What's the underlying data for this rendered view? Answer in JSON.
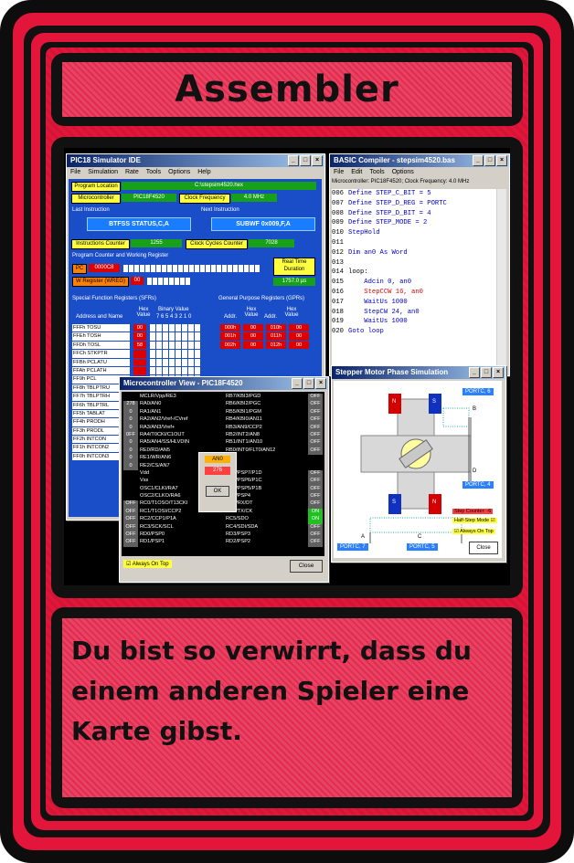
{
  "card": {
    "title": "Assembler",
    "description": "Du bist so verwirrt, dass du einem anderen Spieler eine Karte gibst."
  },
  "screenshot": {
    "pic_window": {
      "title": "PIC18 Simulator IDE",
      "menu": [
        "File",
        "Simulation",
        "Rate",
        "Tools",
        "Options",
        "Help"
      ],
      "program_location_label": "Program Location",
      "program_location_value": "C:\\stepsim4520.hex",
      "microcontroller_label": "Microcontroller",
      "microcontroller_value": "PIC18F4520",
      "clock_label": "Clock Frequency",
      "clock_value": "4.0 MHz",
      "last_instruction_label": "Last Instruction",
      "last_instruction_value": "BTFSS STATUS,C,A",
      "next_instruction_label": "Next Instruction",
      "next_instruction_value": "SUBWF 0x009,F,A",
      "instructions_counter_label": "Instructions Counter",
      "instructions_counter_value": "1255",
      "clock_cycles_label": "Clock Cycles Counter",
      "clock_cycles_value": "7028",
      "pc_group_label": "Program Counter and Working Register",
      "pc_label": "PC",
      "pc_value": "0000C8",
      "w_label": "W Register (WREG)",
      "w_value": "00",
      "realtime_label": "Real Time Duration",
      "realtime_value": "1757.0 µs",
      "sfr_label": "Special Function Registers (SFRs)",
      "sfr_col1": "Address and Name",
      "sfr_col2": "Hex Value",
      "sfr_col3": "Binary Value",
      "sfr_bits": "7 6 5 4 3 2 1 0",
      "gpr_label": "General Purpose Registers (GPRs)",
      "gpr_col_addr": "Addr.",
      "gpr_col_hex": "Hex Value",
      "sfr_rows": [
        {
          "name": "FFFh TOSU",
          "val": "00"
        },
        {
          "name": "FFEh TOSH",
          "val": "00"
        },
        {
          "name": "FFDh TOSL",
          "val": "58"
        },
        {
          "name": "FFCh STKPTR",
          "val": ""
        },
        {
          "name": "FFBh PCLATU",
          "val": ""
        },
        {
          "name": "FFAh PCLATH",
          "val": ""
        },
        {
          "name": "FF9h PCL",
          "val": ""
        },
        {
          "name": "FF8h TBLPTRU",
          "val": ""
        },
        {
          "name": "FF7h TBLPTRH",
          "val": ""
        },
        {
          "name": "FF6h TBLPTRL",
          "val": ""
        },
        {
          "name": "FF5h TABLAT",
          "val": ""
        },
        {
          "name": "FF4h PRODH",
          "val": ""
        },
        {
          "name": "FF3h PRODL",
          "val": ""
        },
        {
          "name": "FF2h INTCON",
          "val": ""
        },
        {
          "name": "FF1h INTCON2",
          "val": ""
        },
        {
          "name": "FF0h INTCON3",
          "val": ""
        }
      ],
      "gpr_rows": [
        {
          "a1": "000h",
          "v1": "00",
          "a2": "010h",
          "v2": "00"
        },
        {
          "a1": "001h",
          "v1": "00",
          "a2": "011h",
          "v2": "00"
        },
        {
          "a1": "002h",
          "v1": "00",
          "a2": "012h",
          "v2": "00"
        }
      ]
    },
    "basic_window": {
      "title": "BASIC Compiler - stepsim4520.bas",
      "menu": [
        "File",
        "Edit",
        "Tools",
        "Options"
      ],
      "status": "Microcontroller: PIC18F4520; Clock Frequency: 4.0 MHz",
      "lines": [
        {
          "n": "006",
          "t": "Define STEP_C_BIT = 5",
          "c": "blue"
        },
        {
          "n": "007",
          "t": "Define STEP_D_REG = PORTC",
          "c": "blue"
        },
        {
          "n": "008",
          "t": "Define STEP_D_BIT = 4",
          "c": "blue"
        },
        {
          "n": "009",
          "t": "Define STEP_MODE = 2",
          "c": "blue"
        },
        {
          "n": "010",
          "t": "StepHold",
          "c": "blue"
        },
        {
          "n": "011",
          "t": "",
          "c": ""
        },
        {
          "n": "012",
          "t": "Dim an0 As Word",
          "c": "blue"
        },
        {
          "n": "013",
          "t": "",
          "c": ""
        },
        {
          "n": "014",
          "t": "loop:",
          "c": ""
        },
        {
          "n": "015",
          "t": "    Adcin 0, an0",
          "c": "blue"
        },
        {
          "n": "016",
          "t": "    StepCCW 16, an0",
          "c": "red"
        },
        {
          "n": "017",
          "t": "    WaitUs 1000",
          "c": "blue"
        },
        {
          "n": "018",
          "t": "    StepCW 24, an0",
          "c": "blue"
        },
        {
          "n": "019",
          "t": "    WaitUs 1000",
          "c": "blue"
        },
        {
          "n": "020",
          "t": "Goto loop",
          "c": "blue"
        }
      ]
    },
    "mc_window": {
      "title": "Microcontroller View - PIC18F4520",
      "left_pins": [
        "MCLR/Vpp/RE3",
        "RA0/AN0",
        "RA1/AN1",
        "RA2/AN2/Vref-/CVref",
        "RA3/AN3/Vref+",
        "RA4/T0CKI/C1OUT",
        "RA5/AN4/SS/HLVDIN",
        "RE0/RD/AN5",
        "RE1/WR/AN6",
        "RE2/CS/AN7",
        "Vdd",
        "Vss",
        "OSC1/CLKI/RA7",
        "OSC2/CLKO/RA6",
        "RC0/T1OSO/T13CKI",
        "RC1/T1OSI/CCP2",
        "RC2/CCP1/P1A",
        "RC3/SCK/SCL",
        "RD0/PSP0",
        "RD1/PSP1"
      ],
      "left_vals": [
        "",
        "278",
        "0",
        "0",
        "0",
        "0FF",
        "0",
        "0",
        "0",
        "0",
        "",
        "",
        "",
        "",
        "OFF",
        "OFF",
        "OFF",
        "OFF",
        "OFF",
        "OFF"
      ],
      "right_pins": [
        "RB7/KBI3/PGD",
        "RB6/KBI2/PGC",
        "RB5/KBI1/PGM",
        "RB4/KBI0/AN11",
        "RB3/AN9/CCP2",
        "RB2/INT2/AN8",
        "RB1/INT1/AN10",
        "RB0/INT0/FLT0/AN12",
        "",
        "",
        "RD7/PSP7/P1D",
        "RD6/PSP6/P1C",
        "RD5/PSP5/P1B",
        "RD4/PSP4",
        "RC7/RX/DT",
        "RC6/TX/CK",
        "RC5/SDO",
        "RC4/SDI/SDA",
        "RD3/PSP3",
        "RD2/PSP2"
      ],
      "right_vals": [
        "OFF",
        "OFF",
        "OFF",
        "OFF",
        "OFF",
        "OFF",
        "OFF",
        "OFF",
        "",
        "",
        "OFF",
        "OFF",
        "OFF",
        "OFF",
        "OFF",
        "ON",
        "ON",
        "OFF",
        "OFF",
        "OFF"
      ],
      "popup_label": "AN0",
      "popup_value": "276",
      "popup_ok": "OK",
      "always_on_top": "Always On Top",
      "close": "Close"
    },
    "stepper_window": {
      "title": "Stepper Motor Phase Simulation",
      "port_labels": [
        "PORTC, 6",
        "PORTC, 4",
        "PORTC, 7",
        "PORTC, 5"
      ],
      "coil_labels": [
        "B",
        "D",
        "A",
        "C"
      ],
      "pole_labels": [
        "N",
        "S",
        "S",
        "N"
      ],
      "step_counter": "Step Counter: -6",
      "half_step": "Half-Step Mode",
      "always_on_top": "Always On Top",
      "close": "Close"
    }
  },
  "colors": {
    "card_red": "#e3153a",
    "border_black": "#111111",
    "ide_blue": "#1a4ec8"
  }
}
